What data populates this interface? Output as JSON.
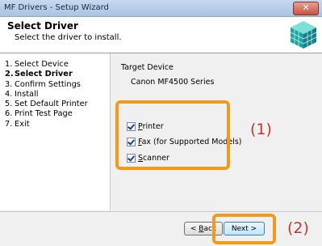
{
  "window": {
    "title": "MF Drivers - Setup Wizard",
    "close_label": "✕"
  },
  "header": {
    "title": "Select Driver",
    "subtitle": "Select the driver to install."
  },
  "steps": [
    {
      "num": "1.",
      "label": "Select Device"
    },
    {
      "num": "2.",
      "label": "Select Driver"
    },
    {
      "num": "3.",
      "label": "Confirm Settings"
    },
    {
      "num": "4.",
      "label": "Install"
    },
    {
      "num": "5.",
      "label": "Set Default Printer"
    },
    {
      "num": "6.",
      "label": "Print Test Page"
    },
    {
      "num": "7.",
      "label": "Exit"
    }
  ],
  "active_step_index": 1,
  "content": {
    "target_device_label": "Target Device",
    "target_device_value": "Canon MF4500 Series",
    "checkboxes": [
      {
        "key": "P",
        "rest": "rinter",
        "checked": true
      },
      {
        "key": "F",
        "rest": "ax (for Supported Models)",
        "checked": true
      },
      {
        "key": "S",
        "rest": "canner",
        "checked": true
      }
    ]
  },
  "annotations": {
    "callout_1": "(1)",
    "callout_2": "(2)",
    "highlight_color": "#f39a1b",
    "callout_color": "#c0392b"
  },
  "footer": {
    "back_key": "B",
    "back_prefix": "< ",
    "back_rest": "ack",
    "next_label": "Next >"
  }
}
